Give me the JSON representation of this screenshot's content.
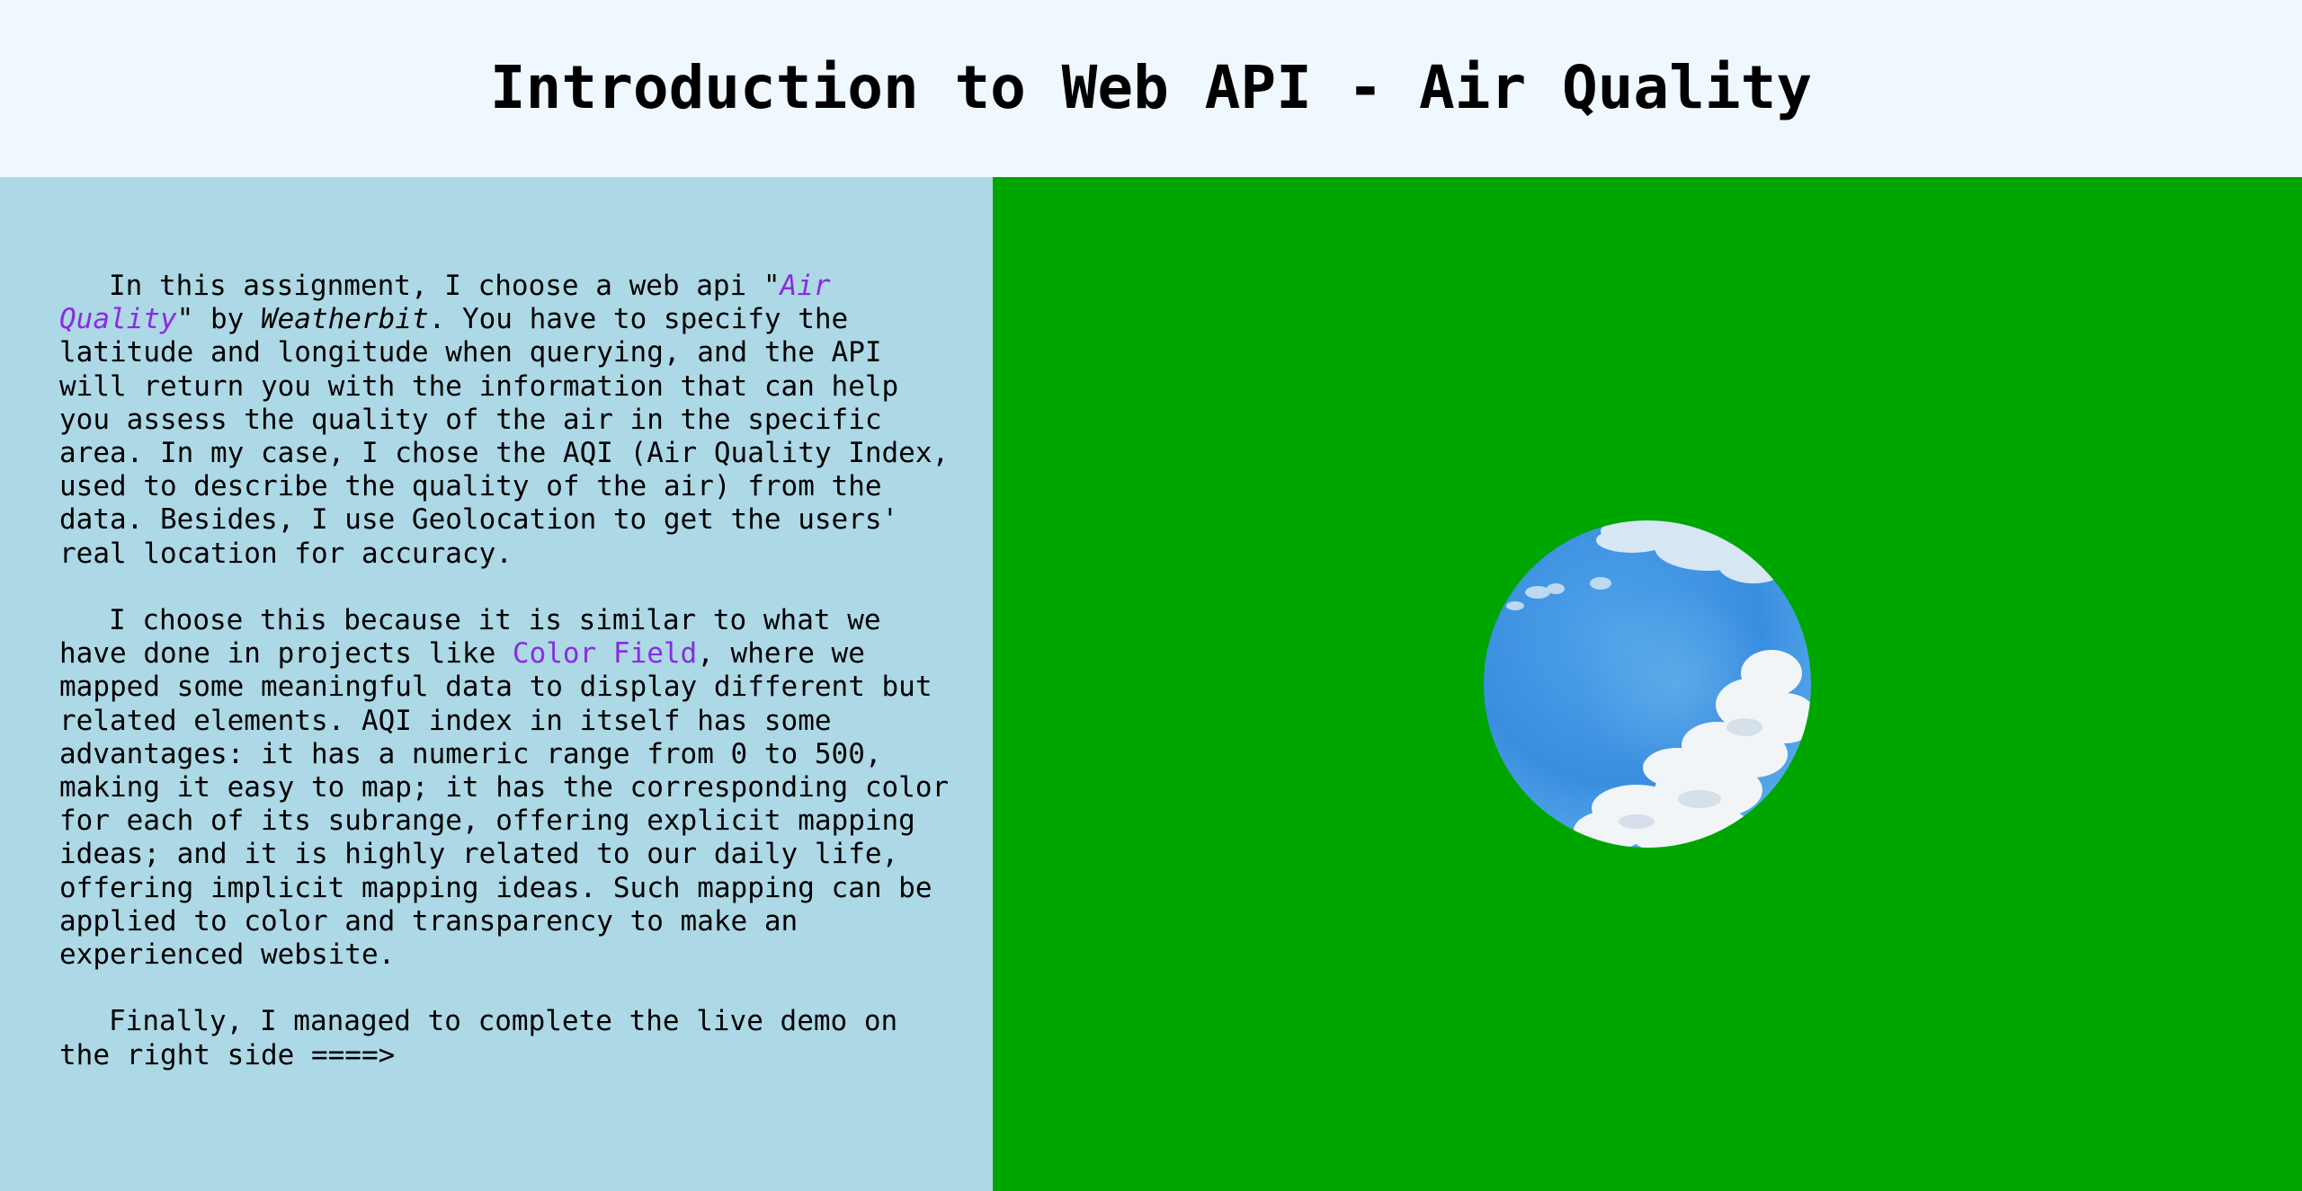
{
  "header": {
    "title": "Introduction to Web API - Air Quality"
  },
  "content": {
    "p1_before_api": "In this assignment, I choose a web api \"",
    "api_name": "Air Quality",
    "p1_by": "\" by ",
    "provider": "Weatherbit",
    "p1_rest": ". You have to specify the latitude and longitude when querying, and the API will return you with the information that can help you assess the quality of the air in the specific area. In my case, I chose the AQI (Air Quality Index, used to describe the quality of the air) from the data. Besides, I use Geolocation to get the users' real location for accuracy.",
    "p2_before_link": "I choose this because it is similar to what we have done in projects like ",
    "project_link": "Color Field",
    "p2_rest": ", where we mapped some meaningful data to display different but related elements. AQI index in itself has some advantages: it has a numeric range from 0 to 500, making it easy to map; it has the corresponding color for each of its subrange, offering explicit mapping ideas; and it is highly related to our daily life, offering implicit mapping ideas. Such mapping can be applied to color and transparency to make an experienced website.",
    "p3": "Finally, I managed to complete the live demo on the right side ====>"
  },
  "demo": {
    "background_color": "#00a600",
    "sky_color": "#3a8ee0",
    "visual": "sky-orb"
  },
  "colors": {
    "header_bg": "#f0f8ff",
    "panel_bg": "#add8e6",
    "link": "#8a2be2"
  }
}
